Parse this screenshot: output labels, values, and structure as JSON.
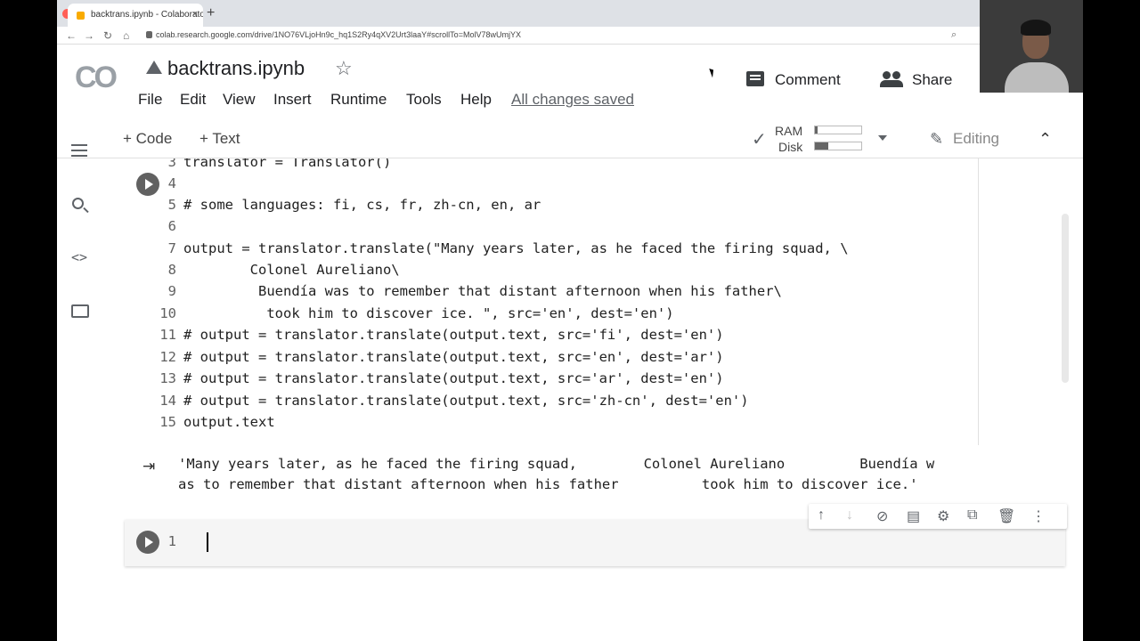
{
  "browser": {
    "tab_title": "backtrans.ipynb - Colaborato",
    "tab_close": "×",
    "new_tab": "+",
    "url": "colab.research.google.com/drive/1NO76VLjoHn9c_hq1S2Ry4qXV2Urt3laaY#scrollTo=MolV78wUmjYX",
    "nav": {
      "back": "←",
      "forward": "→",
      "reload": "↻",
      "home": "⌂"
    }
  },
  "header": {
    "logo": "CO",
    "doc_title": "backtrans.ipynb",
    "star": "☆",
    "comment_label": "Comment",
    "share_label": "Share"
  },
  "menu": {
    "items": [
      "File",
      "Edit",
      "View",
      "Insert",
      "Runtime",
      "Tools",
      "Help"
    ],
    "status": "All changes saved"
  },
  "toolbar": {
    "add_code": "+ Code",
    "add_text": "+ Text",
    "ram_label": "RAM",
    "disk_label": "Disk",
    "ram_usage": 0.05,
    "disk_usage": 0.28,
    "check": "✓",
    "editing_label": "Editing",
    "collapse": "⌃",
    "pencil": "✎"
  },
  "sidenav": {
    "code_snippets_icon": "<>"
  },
  "code_cell": {
    "lines": [
      {
        "num": "3",
        "text": "translator = Translator()"
      },
      {
        "num": "4",
        "text": ""
      },
      {
        "num": "5",
        "text": "# some languages: fi, cs, fr, zh-cn, en, ar"
      },
      {
        "num": "6",
        "text": ""
      },
      {
        "num": "7",
        "text": "output = translator.translate(\"Many years later, as he faced the firing squad, \\"
      },
      {
        "num": "8",
        "text": "        Colonel Aureliano\\"
      },
      {
        "num": "9",
        "text": "         Buendía was to remember that distant afternoon when his father\\"
      },
      {
        "num": "10",
        "text": "          took him to discover ice. \", src='en', dest='en')"
      },
      {
        "num": "11",
        "text": "# output = translator.translate(output.text, src='fi', dest='en')"
      },
      {
        "num": "12",
        "text": "# output = translator.translate(output.text, src='en', dest='ar')"
      },
      {
        "num": "13",
        "text": "# output = translator.translate(output.text, src='ar', dest='en')"
      },
      {
        "num": "14",
        "text": "# output = translator.translate(output.text, src='zh-cn', dest='en')"
      },
      {
        "num": "15",
        "text": "output.text"
      }
    ]
  },
  "output": {
    "icon": "⇥",
    "line1": "'Many years later, as he faced the firing squad,        Colonel Aureliano         Buendía w",
    "line2": "as to remember that distant afternoon when his father          took him to discover ice.'"
  },
  "cell_tools": {
    "move_up": "↑",
    "move_down": "↓",
    "link": "⊘",
    "comment": "▤",
    "settings": "⚙",
    "mirror": "⧉",
    "delete": "🗑",
    "more": "⋮"
  },
  "empty_cell": {
    "line_number": "1"
  }
}
